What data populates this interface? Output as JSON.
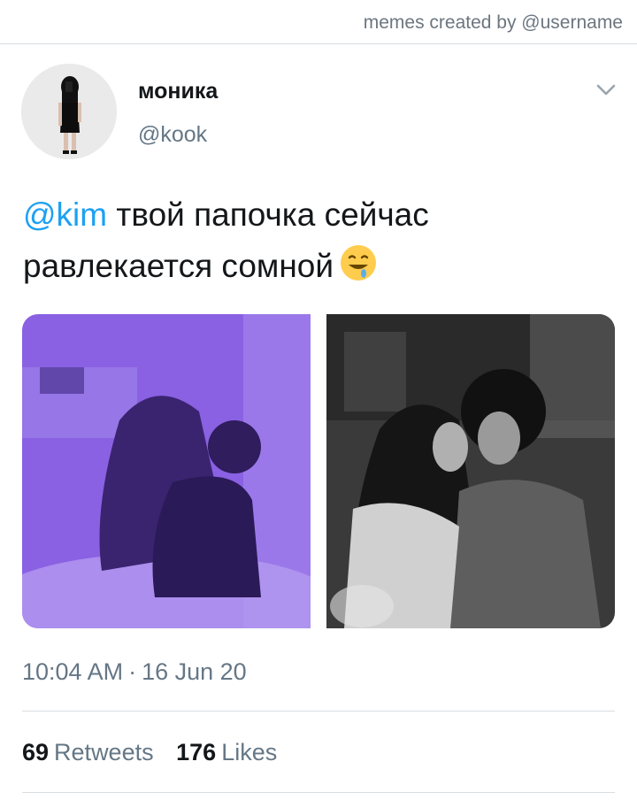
{
  "watermark": "memes created by @username",
  "tweet": {
    "display_name": "моника",
    "handle": "@kook",
    "mention": "@kim",
    "text_line1": " твой папочка сейчас",
    "text_line2": "равлекается сомной",
    "emoji": "drooling-face",
    "time": "10:04 AM",
    "separator": "·",
    "date": "16 Jun 20"
  },
  "stats": {
    "retweets_count": "69",
    "retweets_label": "Retweets",
    "likes_count": "176",
    "likes_label": "Likes"
  },
  "colors": {
    "mention": "#1da1f2",
    "secondary_text": "#657786",
    "photo_left_tint": "#7d55d6",
    "divider": "#d8dde2"
  }
}
